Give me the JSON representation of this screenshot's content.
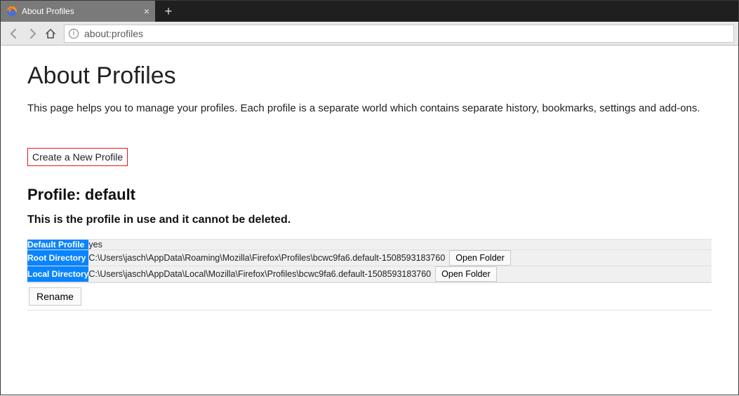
{
  "browser": {
    "tab_title": "About Profiles",
    "url": "about:profiles"
  },
  "page": {
    "heading": "About Profiles",
    "description": "This page helps you to manage your profiles. Each profile is a separate world which contains separate history, bookmarks, settings and add-ons.",
    "create_button": "Create a New Profile"
  },
  "profile": {
    "heading": "Profile: default",
    "inuse_notice": "This is the profile in use and it cannot be deleted.",
    "rows": {
      "default_profile": {
        "label": "Default Profile",
        "value": "yes"
      },
      "root_dir": {
        "label": "Root Directory",
        "value": "C:\\Users\\jasch\\AppData\\Roaming\\Mozilla\\Firefox\\Profiles\\bcwc9fa6.default-1508593183760",
        "button": "Open Folder"
      },
      "local_dir": {
        "label": "Local Directory",
        "value": "C:\\Users\\jasch\\AppData\\Local\\Mozilla\\Firefox\\Profiles\\bcwc9fa6.default-1508593183760",
        "button": "Open Folder"
      }
    },
    "rename_button": "Rename"
  }
}
